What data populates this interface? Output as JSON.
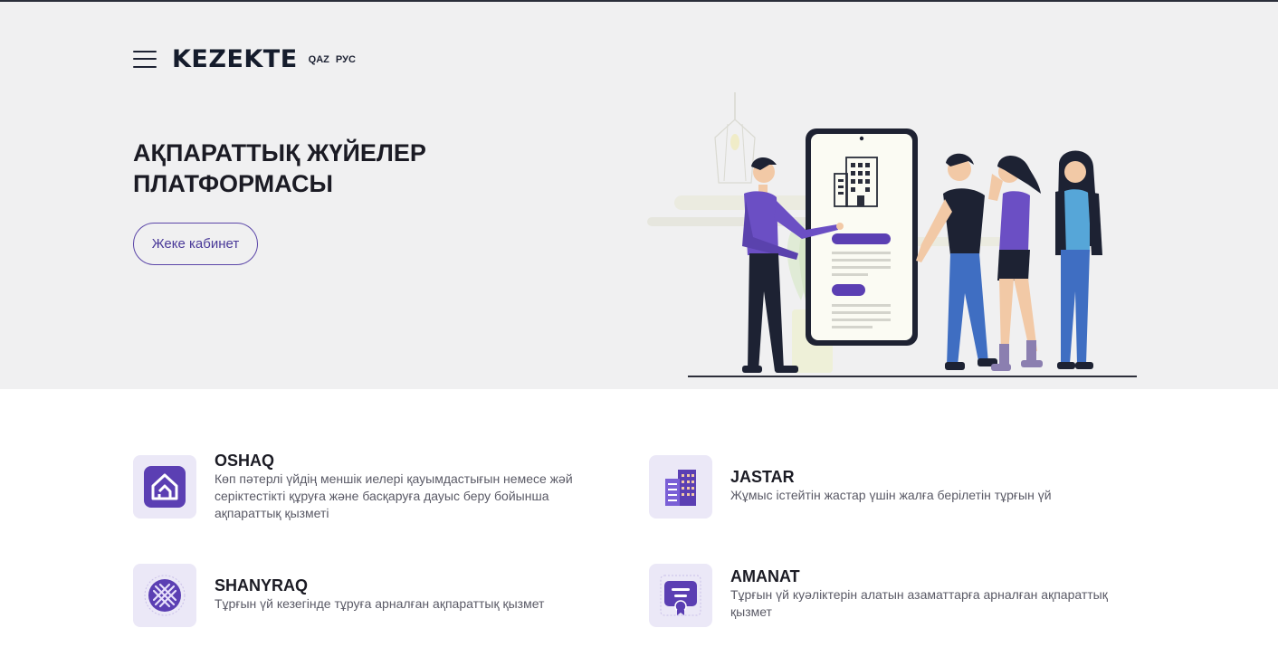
{
  "header": {
    "logo": "KEZEKTE",
    "languages": [
      "QAZ",
      "РУС"
    ],
    "menu_icon": "hamburger-menu-icon"
  },
  "hero": {
    "title": "АҚПАРАТТЫҚ ЖҮЙЕЛЕР ПЛАТФОРМАСЫ",
    "cabinet_button": "Жеке кабинет",
    "illustration": "people-with-phone-illustration"
  },
  "services": [
    {
      "title": "OSHAQ",
      "description": "Көп пәтерлі үйдің меншік иелері қауымдастығын немесе жәй серіктестікті құруға және басқаруға дауыс беру бойынша ақпараттық қызметі",
      "icon": "house-logo-icon"
    },
    {
      "title": "JASTAR",
      "description": "Жұмыс істейтін жастар үшін жалға берілетін тұрғын үй",
      "icon": "buildings-icon"
    },
    {
      "title": "SHANYRAQ",
      "description": "Тұрғын үй кезегінде тұруға арналған ақпараттық қызмет",
      "icon": "shanyraq-icon"
    },
    {
      "title": "AMANAT",
      "description": "Тұрғын үй куәліктерін алатын азаматтарға арналған ақпараттық қызмет",
      "icon": "certificate-icon"
    }
  ],
  "colors": {
    "accent": "#5b3fb3",
    "hero_bg": "#f0f0f1",
    "icon_bg": "#ebe8f7"
  }
}
